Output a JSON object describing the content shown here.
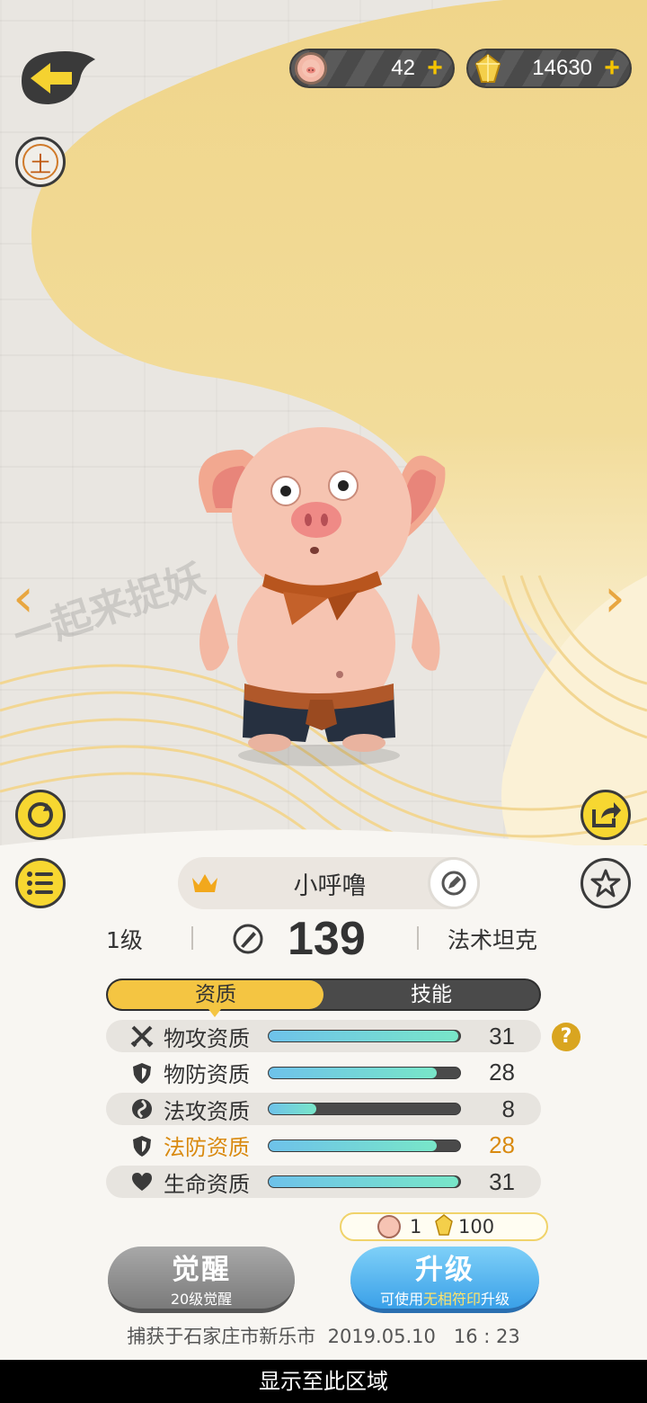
{
  "currency": {
    "pig_count": "42",
    "crystal_count": "14630",
    "plus_symbol": "+"
  },
  "watermark_text": "一起来捉妖",
  "nav": {
    "prev_arrow": "‹",
    "next_arrow": "›",
    "land_badge": "土"
  },
  "pet": {
    "name": "小呼噜",
    "level": "1级",
    "power": "139",
    "role": "法术坦克"
  },
  "tabs": [
    {
      "label": "资质",
      "active": true
    },
    {
      "label": "技能",
      "active": false
    }
  ],
  "aptitudes": [
    {
      "icon": "swords-icon",
      "label": "物攻资质",
      "value": "31",
      "progress": 0.99,
      "highlight": false
    },
    {
      "icon": "shield-icon",
      "label": "物防资质",
      "value": "28",
      "progress": 0.88,
      "highlight": false
    },
    {
      "icon": "magic-orb-icon",
      "label": "法攻资质",
      "value": "8",
      "progress": 0.25,
      "highlight": false
    },
    {
      "icon": "shield-icon",
      "label": "法防资质",
      "value": "28",
      "progress": 0.88,
      "highlight": true
    },
    {
      "icon": "heart-icon",
      "label": "生命资质",
      "value": "31",
      "progress": 0.99,
      "highlight": false
    }
  ],
  "help_symbol": "?",
  "upgrade_cost": {
    "pig_cost": "1",
    "crystal_cost": "100"
  },
  "buttons": {
    "awaken_title": "觉醒",
    "awaken_sub": "20级觉醒",
    "upgrade_title": "升级",
    "upgrade_sub_a": "可使用",
    "upgrade_sub_b": "无相符印",
    "upgrade_sub_c": "升级"
  },
  "caught_info": "捕获于石家庄市新乐市  2019.05.10   16 : 23",
  "bottom_bar": "显示至此区域",
  "colors": {
    "accent_yellow": "#f4c542",
    "highlight_orange": "#d98a10",
    "bar_fill": "#6ec2ea"
  }
}
